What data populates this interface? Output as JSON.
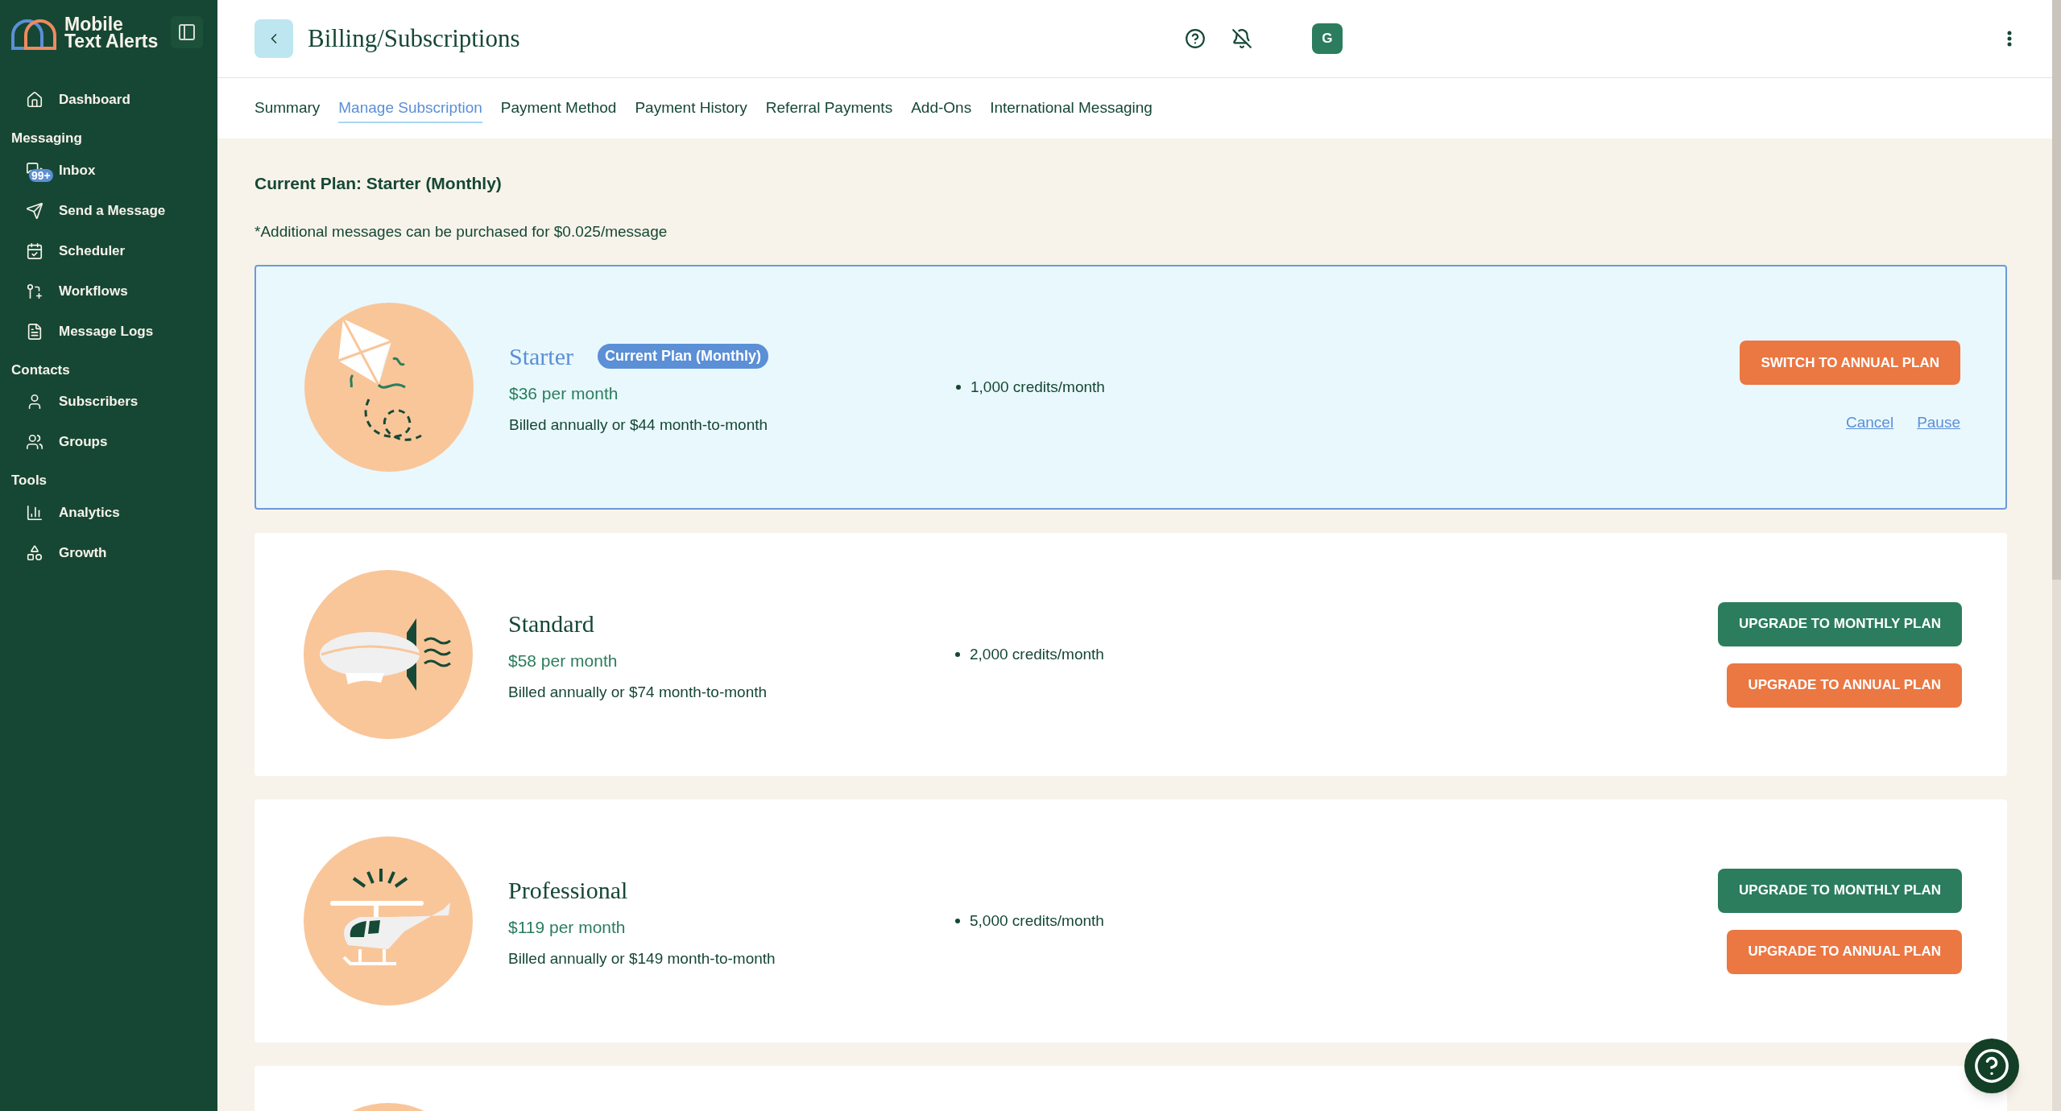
{
  "sidebar": {
    "logo": [
      "Mobile",
      "Text Alerts"
    ],
    "sections": [
      {
        "items": [
          {
            "label": "Dashboard"
          }
        ]
      },
      {
        "heading": "Messaging",
        "items": [
          {
            "label": "Inbox",
            "badge": "99+"
          },
          {
            "label": "Send a Message"
          },
          {
            "label": "Scheduler"
          },
          {
            "label": "Workflows"
          },
          {
            "label": "Message Logs"
          }
        ]
      },
      {
        "heading": "Contacts",
        "items": [
          {
            "label": "Subscribers"
          },
          {
            "label": "Groups"
          }
        ]
      },
      {
        "heading": "Tools",
        "items": [
          {
            "label": "Analytics"
          },
          {
            "label": "Growth"
          }
        ]
      }
    ]
  },
  "header": {
    "title": "Billing/Subscriptions",
    "avatar": "G"
  },
  "tabs": [
    {
      "label": "Summary",
      "selected": false
    },
    {
      "label": "Manage Subscription",
      "selected": true
    },
    {
      "label": "Payment Method",
      "selected": false
    },
    {
      "label": "Payment History",
      "selected": false
    },
    {
      "label": "Referral Payments",
      "selected": false
    },
    {
      "label": "Add-Ons",
      "selected": false
    },
    {
      "label": "International Messaging",
      "selected": false
    }
  ],
  "current_plan": "Current Plan: Starter (Monthly)",
  "note": "*Additional messages can be purchased for $0.025/message",
  "plans": [
    {
      "current": true,
      "name": "Starter",
      "badge": "Current Plan (Monthly)",
      "price": "$36 per month",
      "billing": "Billed annually or $44 month-to-month",
      "features": [
        "1,000 credits/month"
      ],
      "actions": [
        {
          "label": "SWITCH TO ANNUAL PLAN",
          "kind": "annual"
        }
      ],
      "links": [
        "Cancel",
        "Pause"
      ]
    },
    {
      "current": false,
      "name": "Standard",
      "price": "$58 per month",
      "billing": "Billed annually or $74 month-to-month",
      "features": [
        "2,000 credits/month"
      ],
      "actions": [
        {
          "label": "UPGRADE TO MONTHLY PLAN",
          "kind": "monthly"
        },
        {
          "label": "UPGRADE TO ANNUAL PLAN",
          "kind": "annual"
        }
      ]
    },
    {
      "current": false,
      "name": "Professional",
      "price": "$119 per month",
      "billing": "Billed annually or $149 month-to-month",
      "features": [
        "5,000 credits/month"
      ],
      "actions": [
        {
          "label": "UPGRADE TO MONTHLY PLAN",
          "kind": "monthly"
        },
        {
          "label": "UPGRADE TO ANNUAL PLAN",
          "kind": "annual"
        }
      ]
    },
    {
      "current": false
    }
  ]
}
